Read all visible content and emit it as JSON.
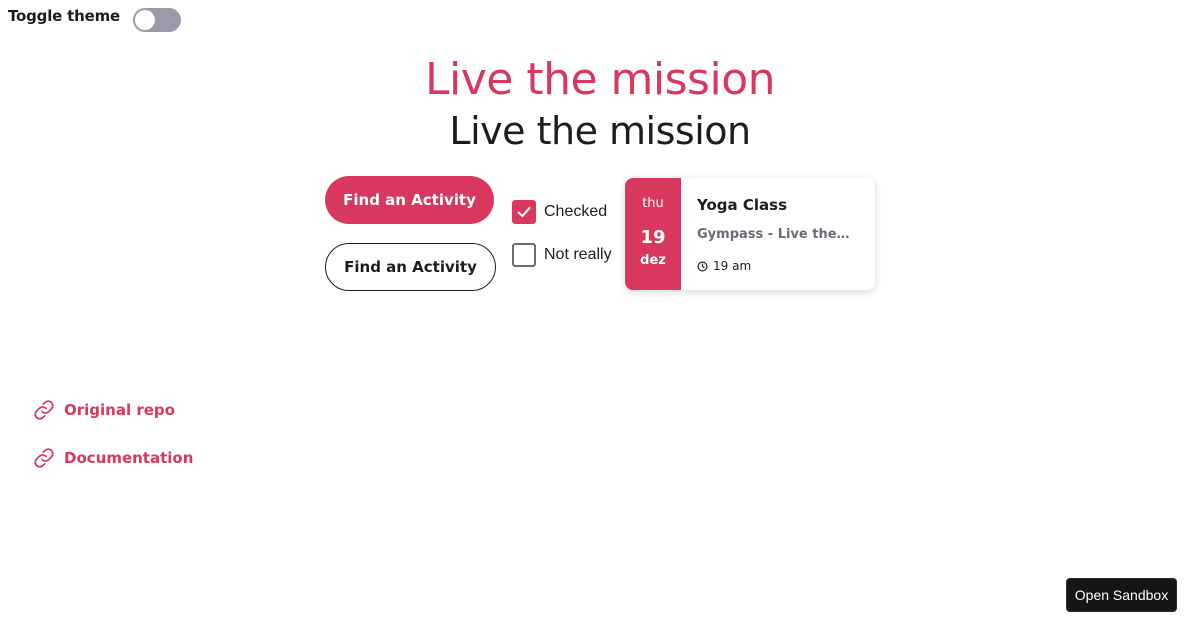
{
  "theme_toggle": {
    "label": "Toggle theme",
    "enabled": false
  },
  "headings": {
    "primary": "Live the mission",
    "secondary": "Live the mission"
  },
  "buttons": {
    "primary_label": "Find an Activity",
    "outline_label": "Find an Activity"
  },
  "checkboxes": [
    {
      "label": "Checked",
      "checked": true
    },
    {
      "label": "Not really",
      "checked": false
    }
  ],
  "event_card": {
    "weekday": "thu",
    "day": "19",
    "month": "dez",
    "title": "Yoga Class",
    "subtitle": "Gympass - Live the…",
    "time": "19 am",
    "time_icon": "clock-icon"
  },
  "links": [
    {
      "label": "Original repo",
      "icon": "link-icon"
    },
    {
      "label": "Documentation",
      "icon": "link-icon"
    }
  ],
  "sandbox": {
    "label": "Open Sandbox"
  },
  "colors": {
    "accent": "#d8385e",
    "text": "#1d1d1f",
    "muted": "#6b6b78",
    "toggle_track": "#9b9aa8",
    "sandbox_bg": "#151515"
  }
}
